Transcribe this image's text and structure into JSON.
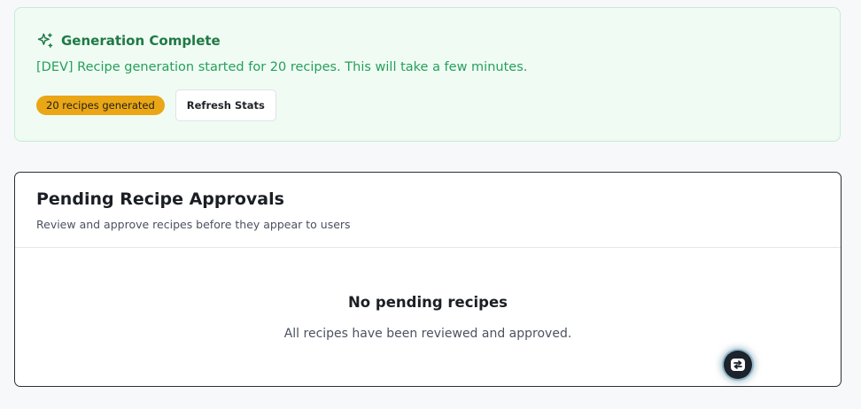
{
  "banner": {
    "icon": "sparkles-icon",
    "title": "Generation Complete",
    "message": "[DEV] Recipe generation started for 20 recipes. This will take a few minutes.",
    "badge": "20 recipes generated",
    "refresh_label": "Refresh Stats",
    "colors": {
      "background": "#f0fbf4",
      "title": "#1f7a44",
      "message": "#26a05a",
      "badge": "#eaa614"
    }
  },
  "approvals": {
    "title": "Pending Recipe Approvals",
    "subtitle": "Review and approve recipes before they appear to users",
    "empty_title": "No pending recipes",
    "empty_text": "All recipes have been reviewed and approved."
  },
  "fab": {
    "icon": "swap-icon"
  }
}
